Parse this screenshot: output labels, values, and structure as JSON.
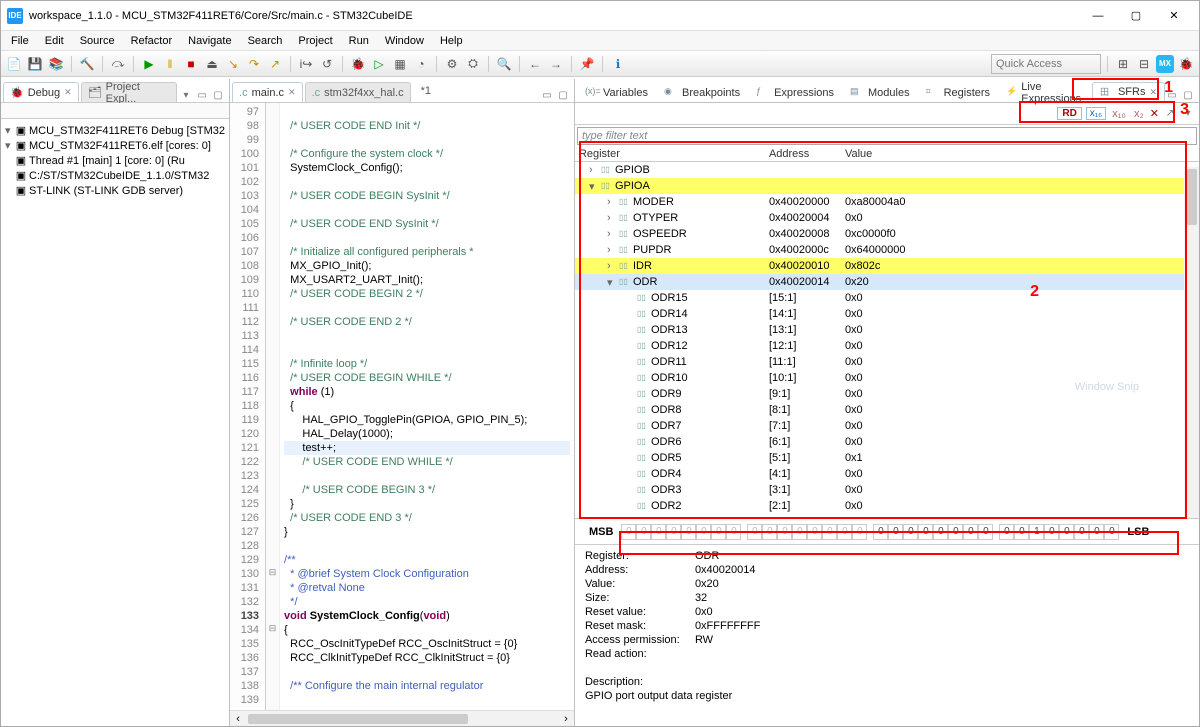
{
  "title": "workspace_1.1.0 - MCU_STM32F411RET6/Core/Src/main.c - STM32CubeIDE",
  "menus": [
    "File",
    "Edit",
    "Source",
    "Refactor",
    "Navigate",
    "Search",
    "Project",
    "Run",
    "Window",
    "Help"
  ],
  "quick_access_placeholder": "Quick Access",
  "left": {
    "tab_debug": "Debug",
    "tab_project": "Project Expl...",
    "tree": [
      {
        "lvl": 0,
        "chev": "▾",
        "icon": "IDE",
        "label": "MCU_STM32F411RET6 Debug [STM32"
      },
      {
        "lvl": 1,
        "chev": "▾",
        "icon": "elf",
        "label": "MCU_STM32F411RET6.elf [cores: 0]"
      },
      {
        "lvl": 2,
        "chev": "",
        "icon": "thr",
        "label": "Thread #1 [main] 1 [core: 0] (Ru"
      },
      {
        "lvl": 1,
        "chev": "",
        "icon": "exe",
        "label": "C:/ST/STM32CubeIDE_1.1.0/STM32"
      },
      {
        "lvl": 1,
        "chev": "",
        "icon": "srv",
        "label": "ST-LINK (ST-LINK GDB server)"
      }
    ]
  },
  "editor": {
    "tabs": [
      "main.c",
      "stm32f4xx_hal.c"
    ],
    "dirty_label": "*1",
    "first_line": 97,
    "lines": [
      {
        "t": "",
        "c": [
          ""
        ]
      },
      {
        "t": "com",
        "c": [
          "  /* USER CODE END Init */"
        ]
      },
      {
        "t": "",
        "c": [
          ""
        ]
      },
      {
        "t": "com",
        "c": [
          "  /* Configure the system clock */"
        ]
      },
      {
        "t": "",
        "c": [
          "  SystemClock_Config();"
        ]
      },
      {
        "t": "",
        "c": [
          ""
        ]
      },
      {
        "t": "com",
        "c": [
          "  /* USER CODE BEGIN SysInit */"
        ]
      },
      {
        "t": "",
        "c": [
          ""
        ]
      },
      {
        "t": "com",
        "c": [
          "  /* USER CODE END SysInit */"
        ]
      },
      {
        "t": "",
        "c": [
          ""
        ]
      },
      {
        "t": "com",
        "c": [
          "  /* Initialize all configured peripherals *"
        ]
      },
      {
        "t": "",
        "c": [
          "  MX_GPIO_Init();"
        ]
      },
      {
        "t": "",
        "c": [
          "  MX_USART2_UART_Init();"
        ]
      },
      {
        "t": "com",
        "c": [
          "  /* USER CODE BEGIN 2 */"
        ]
      },
      {
        "t": "",
        "c": [
          ""
        ]
      },
      {
        "t": "com",
        "c": [
          "  /* USER CODE END 2 */"
        ]
      },
      {
        "t": "",
        "c": [
          ""
        ]
      },
      {
        "t": "",
        "c": [
          ""
        ]
      },
      {
        "t": "com",
        "c": [
          "  /* Infinite loop */"
        ]
      },
      {
        "t": "com",
        "c": [
          "  /* USER CODE BEGIN WHILE */"
        ]
      },
      {
        "t": "kw",
        "c": [
          "  while (1)"
        ]
      },
      {
        "t": "",
        "c": [
          "  {"
        ]
      },
      {
        "t": "",
        "c": [
          "      HAL_GPIO_TogglePin(GPIOA, GPIO_PIN_5);"
        ]
      },
      {
        "t": "",
        "c": [
          "      HAL_Delay(1000);"
        ]
      },
      {
        "t": "hl",
        "c": [
          "      test++;"
        ]
      },
      {
        "t": "com",
        "c": [
          "      /* USER CODE END WHILE */"
        ]
      },
      {
        "t": "",
        "c": [
          ""
        ]
      },
      {
        "t": "com",
        "c": [
          "      /* USER CODE BEGIN 3 */"
        ]
      },
      {
        "t": "",
        "c": [
          "  }"
        ]
      },
      {
        "t": "com",
        "c": [
          "  /* USER CODE END 3 */"
        ]
      },
      {
        "t": "",
        "c": [
          "}"
        ]
      },
      {
        "t": "",
        "c": [
          ""
        ]
      },
      {
        "t": "doc",
        "c": [
          "/**"
        ]
      },
      {
        "t": "doc",
        "c": [
          "  * @brief System Clock Configuration"
        ]
      },
      {
        "t": "doc",
        "c": [
          "  * @retval None"
        ]
      },
      {
        "t": "doc",
        "c": [
          "  */"
        ]
      },
      {
        "t": "fnsig",
        "c": [
          "void SystemClock_Config(void)"
        ]
      },
      {
        "t": "",
        "c": [
          "{"
        ]
      },
      {
        "t": "",
        "c": [
          "  RCC_OscInitTypeDef RCC_OscInitStruct = {0}"
        ]
      },
      {
        "t": "",
        "c": [
          "  RCC_ClkInitTypeDef RCC_ClkInitStruct = {0}"
        ]
      },
      {
        "t": "",
        "c": [
          ""
        ]
      },
      {
        "t": "doc",
        "c": [
          "  /** Configure the main internal regulator "
        ]
      },
      {
        "t": "",
        "c": [
          "   "
        ]
      }
    ],
    "foldable": [
      130,
      134
    ]
  },
  "views": [
    "Variables",
    "Breakpoints",
    "Expressions",
    "Modules",
    "Registers",
    "Live Expressions",
    "SFRs"
  ],
  "sfr": {
    "rd": "RD",
    "x16": "x₁₆",
    "x10": "x₁₀",
    "x2": "x₂",
    "filter_placeholder": "type filter text",
    "cols": [
      "Register",
      "Address",
      "Value"
    ],
    "rows": [
      {
        "ind": 0,
        "chev": "›",
        "name": "GPIOB",
        "addr": "",
        "val": "",
        "hl": ""
      },
      {
        "ind": 0,
        "chev": "▾",
        "name": "GPIOA",
        "addr": "",
        "val": "",
        "hl": "Y"
      },
      {
        "ind": 1,
        "chev": "›",
        "name": "MODER",
        "addr": "0x40020000",
        "val": "0xa80004a0",
        "hl": ""
      },
      {
        "ind": 1,
        "chev": "›",
        "name": "OTYPER",
        "addr": "0x40020004",
        "val": "0x0",
        "hl": ""
      },
      {
        "ind": 1,
        "chev": "›",
        "name": "OSPEEDR",
        "addr": "0x40020008",
        "val": "0xc0000f0",
        "hl": ""
      },
      {
        "ind": 1,
        "chev": "›",
        "name": "PUPDR",
        "addr": "0x4002000c",
        "val": "0x64000000",
        "hl": ""
      },
      {
        "ind": 1,
        "chev": "›",
        "name": "IDR",
        "addr": "0x40020010",
        "val": "0x802c",
        "hl": "Y"
      },
      {
        "ind": 1,
        "chev": "▾",
        "name": "ODR",
        "addr": "0x40020014",
        "val": "0x20",
        "hl": "B"
      },
      {
        "ind": 2,
        "chev": "",
        "name": "ODR15",
        "addr": "[15:1]",
        "val": "0x0",
        "hl": ""
      },
      {
        "ind": 2,
        "chev": "",
        "name": "ODR14",
        "addr": "[14:1]",
        "val": "0x0",
        "hl": ""
      },
      {
        "ind": 2,
        "chev": "",
        "name": "ODR13",
        "addr": "[13:1]",
        "val": "0x0",
        "hl": ""
      },
      {
        "ind": 2,
        "chev": "",
        "name": "ODR12",
        "addr": "[12:1]",
        "val": "0x0",
        "hl": ""
      },
      {
        "ind": 2,
        "chev": "",
        "name": "ODR11",
        "addr": "[11:1]",
        "val": "0x0",
        "hl": ""
      },
      {
        "ind": 2,
        "chev": "",
        "name": "ODR10",
        "addr": "[10:1]",
        "val": "0x0",
        "hl": ""
      },
      {
        "ind": 2,
        "chev": "",
        "name": "ODR9",
        "addr": "[9:1]",
        "val": "0x0",
        "hl": ""
      },
      {
        "ind": 2,
        "chev": "",
        "name": "ODR8",
        "addr": "[8:1]",
        "val": "0x0",
        "hl": ""
      },
      {
        "ind": 2,
        "chev": "",
        "name": "ODR7",
        "addr": "[7:1]",
        "val": "0x0",
        "hl": ""
      },
      {
        "ind": 2,
        "chev": "",
        "name": "ODR6",
        "addr": "[6:1]",
        "val": "0x0",
        "hl": ""
      },
      {
        "ind": 2,
        "chev": "",
        "name": "ODR5",
        "addr": "[5:1]",
        "val": "0x1",
        "hl": ""
      },
      {
        "ind": 2,
        "chev": "",
        "name": "ODR4",
        "addr": "[4:1]",
        "val": "0x0",
        "hl": ""
      },
      {
        "ind": 2,
        "chev": "",
        "name": "ODR3",
        "addr": "[3:1]",
        "val": "0x0",
        "hl": ""
      },
      {
        "ind": 2,
        "chev": "",
        "name": "ODR2",
        "addr": "[2:1]",
        "val": "0x0",
        "hl": ""
      }
    ],
    "bits": {
      "msb": "MSB",
      "lsb": "LSB",
      "cells": [
        "0",
        "0",
        "0",
        "0",
        "0",
        "0",
        "0",
        "0",
        "0",
        "0",
        "0",
        "0",
        "0",
        "0",
        "0",
        "0",
        "0",
        "0",
        "0",
        "0",
        "0",
        "0",
        "0",
        "0",
        "0",
        "0",
        "1",
        "0",
        "0",
        "0",
        "0",
        "0"
      ]
    },
    "info": {
      "Register": "ODR",
      "Address": "0x40020014",
      "Value": "0x20",
      "Size": "32",
      "Reset value": "0x0",
      "Reset mask": "0xFFFFFFFF",
      "Access permission": "RW",
      "Read action": "",
      "": "",
      "Description": "",
      "desc_text": "GPIO port output data register"
    },
    "snip_label": "Window Snip"
  },
  "annotations": {
    "n1": "1",
    "n2": "2",
    "n3": "3"
  }
}
